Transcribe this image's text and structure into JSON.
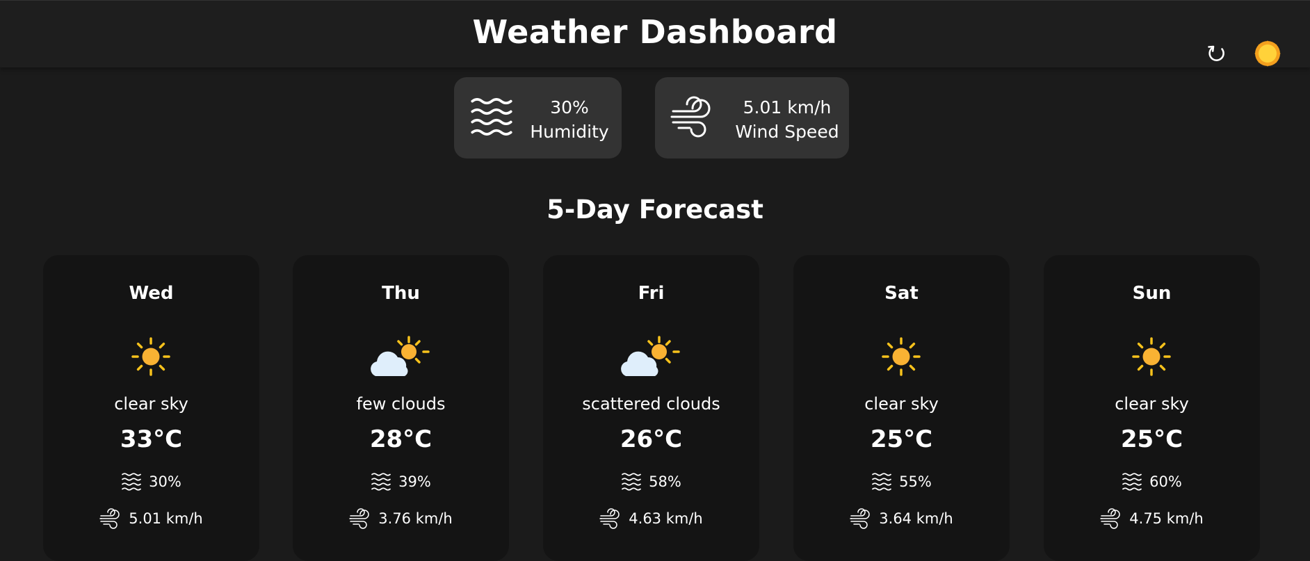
{
  "header": {
    "title": "Weather Dashboard",
    "refresh_icon": "refresh-icon",
    "theme_icon": "sun-icon"
  },
  "current": {
    "humidity_value": "30%",
    "humidity_label": "Humidity",
    "wind_value": "5.01 km/h",
    "wind_label": "Wind Speed"
  },
  "forecast_title": "5-Day Forecast",
  "days": [
    {
      "day": "Wed",
      "icon": "clear-sky-icon",
      "desc": "clear sky",
      "temp": "33°C",
      "humidity": "30%",
      "wind": "5.01 km/h"
    },
    {
      "day": "Thu",
      "icon": "few-clouds-icon",
      "desc": "few clouds",
      "temp": "28°C",
      "humidity": "39%",
      "wind": "3.76 km/h"
    },
    {
      "day": "Fri",
      "icon": "scattered-clouds-icon",
      "desc": "scattered clouds",
      "temp": "26°C",
      "humidity": "58%",
      "wind": "4.63 km/h"
    },
    {
      "day": "Sat",
      "icon": "clear-sky-icon",
      "desc": "clear sky",
      "temp": "25°C",
      "humidity": "55%",
      "wind": "3.64 km/h"
    },
    {
      "day": "Sun",
      "icon": "clear-sky-icon",
      "desc": "clear sky",
      "temp": "25°C",
      "humidity": "60%",
      "wind": "4.75 km/h"
    }
  ],
  "colors": {
    "background": "#1b1b1b",
    "card": "#333333",
    "forecast_card": "#141414",
    "sun": "#f9b233",
    "sun_rays": "#f6c21c",
    "cloud": "#dfeefb"
  }
}
